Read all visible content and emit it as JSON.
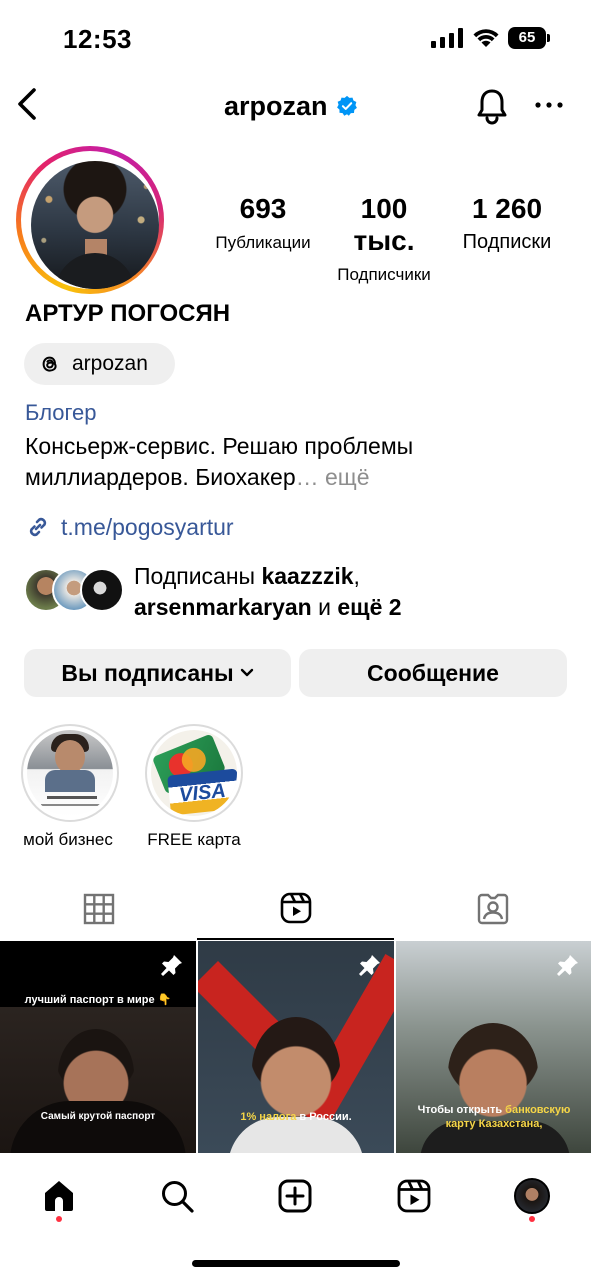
{
  "status_bar": {
    "time": "12:53",
    "battery": "65"
  },
  "header": {
    "username": "arpozan",
    "verified": true,
    "icons": [
      "back-icon",
      "verified-badge-icon",
      "bell-icon",
      "more-icon"
    ]
  },
  "profile": {
    "stats": [
      {
        "value": "693",
        "label": "Публикации"
      },
      {
        "value": "100 тыс.",
        "label": "Подписчики"
      },
      {
        "value": "1 260",
        "label": "Подписки"
      }
    ],
    "full_name": "АРТУР ПОГОСЯН",
    "threads_handle": "arpozan",
    "category": "Блогер",
    "bio_line1": "Консьерж-сервис. Решаю проблемы",
    "bio_line2": "миллиардеров. Биохакер",
    "bio_more": "… ещё",
    "link": "t.me/pogosyartur",
    "followed_by_prefix": "Подписаны ",
    "followed_by_user1": "kaazzzik",
    "followed_by_sep": ",",
    "followed_by_user2": "arsenmarkaryan",
    "followed_by_mid": " и ",
    "followed_by_more": "ещё 2"
  },
  "actions": {
    "following_label": "Вы подписаны",
    "message_label": "Сообщение"
  },
  "highlights": [
    {
      "label": "мой бизнес"
    },
    {
      "label": "FREE карта",
      "card_text_1": "Mastercard",
      "card_text_2": "VISA"
    }
  ],
  "tabs": [
    "grid-icon",
    "reels-icon",
    "tagged-icon"
  ],
  "active_tab": "reels",
  "reels": [
    {
      "caption_top": "лучший паспорт в мире 👇",
      "caption_bottom": "Самый крутой паспорт",
      "pinned": true
    },
    {
      "caption_hi": "1% налога",
      "caption_rest": " в России.",
      "pinned": true
    },
    {
      "caption_line1_a": "Чтобы открыть ",
      "caption_line1_hi": "банковскую",
      "caption_line2": "карту Казахстана,",
      "pinned": true
    }
  ],
  "bottom_nav": [
    "home-icon",
    "search-icon",
    "create-icon",
    "reels-icon",
    "profile-avatar"
  ],
  "colors": {
    "link_blue": "#385898",
    "verified_blue": "#0095f6",
    "chip_gray": "#efefef",
    "notification_red": "#ff3040"
  }
}
